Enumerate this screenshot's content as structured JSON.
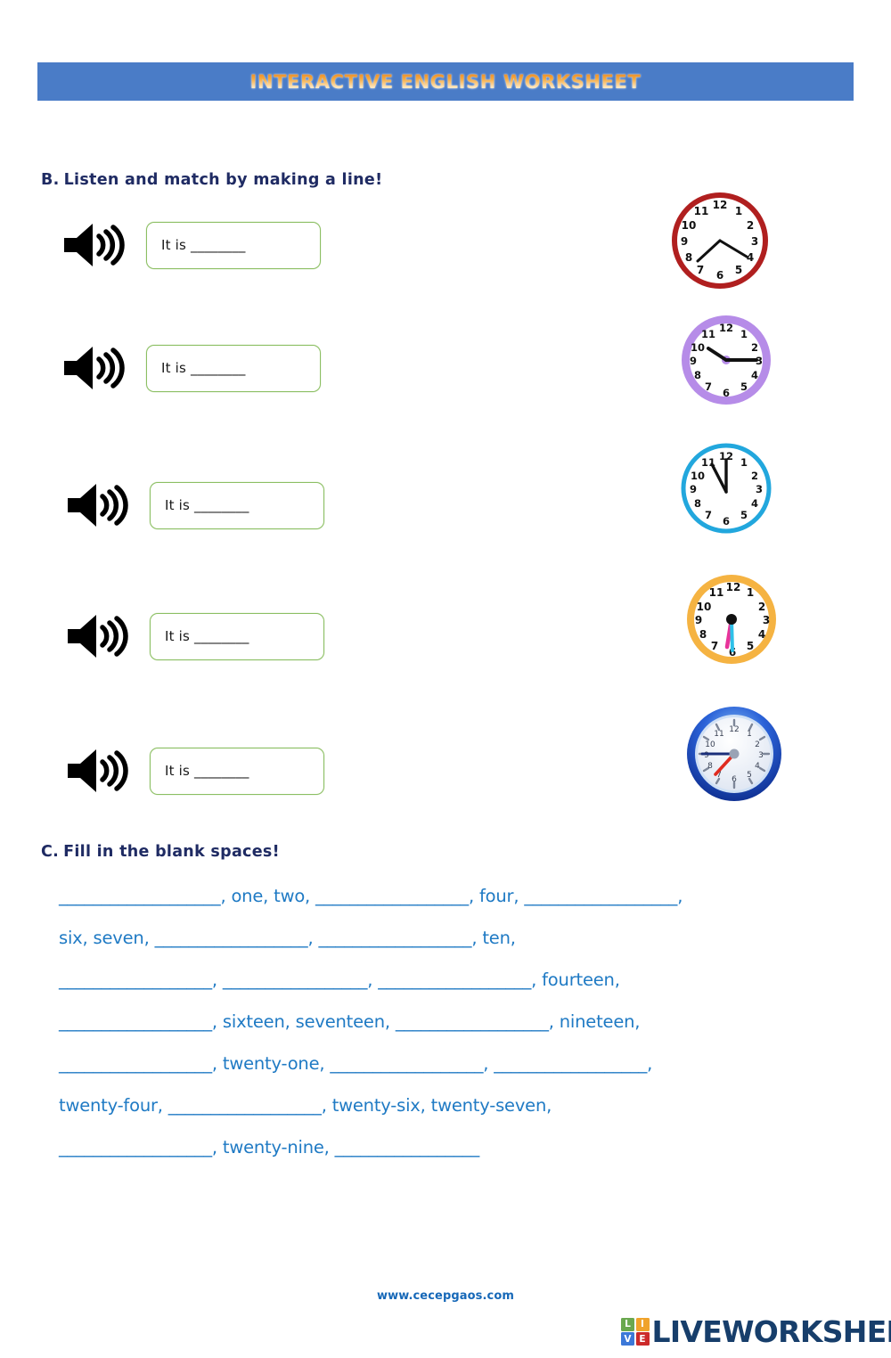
{
  "header": {
    "title": "INTERACTIVE ENGLISH WORKSHEET",
    "banner_color": "#4a7cc7",
    "title_color": "#f0932b"
  },
  "section_b": {
    "letter": "B.",
    "instruction": "Listen and match by making a line!",
    "heading_color": "#1f2b63",
    "items": [
      {
        "id": 1,
        "icon": "speaker-icon",
        "answer_text": "It is ________"
      },
      {
        "id": 2,
        "icon": "speaker-icon",
        "answer_text": "It is ________"
      },
      {
        "id": 3,
        "icon": "speaker-icon",
        "answer_text": "It is ________"
      },
      {
        "id": 4,
        "icon": "speaker-icon",
        "answer_text": "It is ________"
      },
      {
        "id": 5,
        "icon": "speaker-icon",
        "answer_text": "It is ________"
      }
    ],
    "clocks": [
      {
        "id": 1,
        "name": "clock-red",
        "rim_color": "#b01f1f",
        "face_color": "#ffffff",
        "hour_hand_value": 8,
        "minute_hand_value": 4,
        "numerals": [
          "12",
          "1",
          "2",
          "3",
          "4",
          "5",
          "6",
          "7",
          "8",
          "9",
          "10",
          "11"
        ]
      },
      {
        "id": 2,
        "name": "clock-purple",
        "rim_color": "#b68ce8",
        "face_color": "#ffffff",
        "hour_hand_value": 10,
        "minute_hand_value": 3,
        "numerals": [
          "12",
          "1",
          "2",
          "3",
          "4",
          "5",
          "6",
          "7",
          "8",
          "9",
          "10",
          "11"
        ]
      },
      {
        "id": 3,
        "name": "clock-cyan",
        "rim_color": "#22a7dd",
        "face_color": "#ffffff",
        "hour_hand_value": 11,
        "minute_hand_value": 12,
        "numerals": [
          "12",
          "1",
          "2",
          "3",
          "4",
          "5",
          "6",
          "7",
          "8",
          "9",
          "10",
          "11"
        ]
      },
      {
        "id": 4,
        "name": "clock-orange",
        "rim_color": "#f5b342",
        "face_color": "#ffffff",
        "hour_hand_color": "#e8339a",
        "minute_hand_color": "#2ec0e8",
        "hour_hand_value": 6,
        "minute_hand_value": 6,
        "numerals": [
          "12",
          "1",
          "2",
          "3",
          "4",
          "5",
          "6",
          "7",
          "8",
          "9",
          "10",
          "11"
        ]
      },
      {
        "id": 5,
        "name": "clock-blue-glossy",
        "rim_color": "#1c4fc4",
        "face_color": "#f4f7fc",
        "hour_hand_color": "#e02b20",
        "minute_hand_color": "#1b2f7a",
        "hour_hand_value": 8,
        "minute_hand_value": 9,
        "numerals": [
          "12",
          "1",
          "2",
          "3",
          "4",
          "5",
          "6",
          "7",
          "8",
          "9",
          "10",
          "11"
        ]
      }
    ]
  },
  "section_c": {
    "letter": "C.",
    "instruction": "Fill in the blank spaces!",
    "heading_color": "#1f2b63",
    "text_color": "#1f7ac4",
    "lines": [
      "___________________, one, two, __________________, four, __________________,",
      "six, seven, __________________, __________________, ten,",
      "__________________, _________________, __________________, fourteen,",
      "__________________, sixteen, seventeen, __________________, nineteen,",
      "__________________, twenty-one, __________________, __________________,",
      "twenty-four, __________________, twenty-six, twenty-seven,",
      "__________________, twenty-nine, _________________"
    ]
  },
  "footer": {
    "site_url": "www.cecepgaos.com",
    "site_url_color": "#1668b8",
    "logo_word": "LIVEWORKSHEETS",
    "logo_word_color": "#173e6b",
    "logo_tiles": [
      {
        "letter": "L",
        "color": "#6aa84f"
      },
      {
        "letter": "I",
        "color": "#f0a32b"
      },
      {
        "letter": "V",
        "color": "#3c78d8"
      },
      {
        "letter": "E",
        "color": "#cc2a2a"
      }
    ]
  }
}
